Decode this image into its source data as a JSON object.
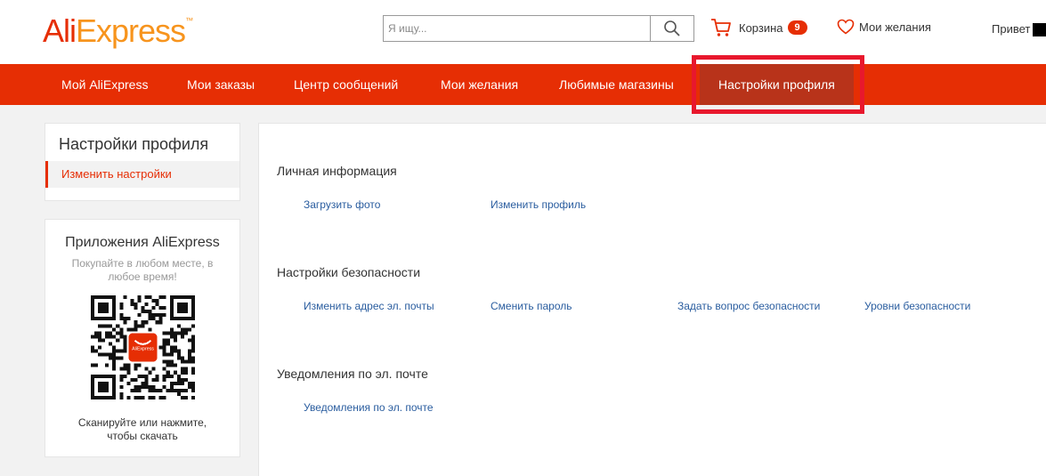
{
  "header": {
    "logo_ali": "Ali",
    "logo_express": "Express",
    "logo_mark": "™",
    "search": {
      "placeholder": "Я ищу...",
      "value": ""
    },
    "cart": {
      "label": "Корзина",
      "count": "9"
    },
    "wishlist_label": "Мои желания",
    "greeting": "Привет"
  },
  "nav": {
    "items": [
      {
        "label": "Мой AliExpress"
      },
      {
        "label": "Мои заказы"
      },
      {
        "label": "Центр сообщений"
      },
      {
        "label": "Мои желания"
      },
      {
        "label": "Любимые магазины"
      },
      {
        "label": "Настройки профиля",
        "active": true
      }
    ]
  },
  "sidebar": {
    "settings": {
      "title": "Настройки профиля",
      "item": "Изменить настройки"
    },
    "apps": {
      "title": "Приложения AliExpress",
      "subtitle": "Покупайте в любом месте, в любое время!",
      "qr_logo": "AliExpress",
      "scan_text": "Сканируйте или нажмите, чтобы скачать"
    }
  },
  "main": {
    "personal": {
      "title": "Личная информация",
      "links": [
        "Загрузить фото",
        "Изменить профиль"
      ]
    },
    "security": {
      "title": "Настройки безопасности",
      "links": [
        "Изменить адрес эл. почты",
        "Сменить пароль",
        "Задать вопрос безопасности",
        "Уровни безопасности"
      ]
    },
    "email": {
      "title": "Уведомления по эл. почте",
      "links": [
        "Уведомления по эл. почте"
      ]
    }
  },
  "colors": {
    "brand_red": "#e62e04",
    "brand_orange": "#f7941d",
    "active_nav": "#b8331a",
    "highlight": "#e8182d",
    "link": "#2a5d9f"
  },
  "icons": {
    "search": "search-icon",
    "cart": "cart-icon",
    "wishlist": "heart-icon"
  }
}
